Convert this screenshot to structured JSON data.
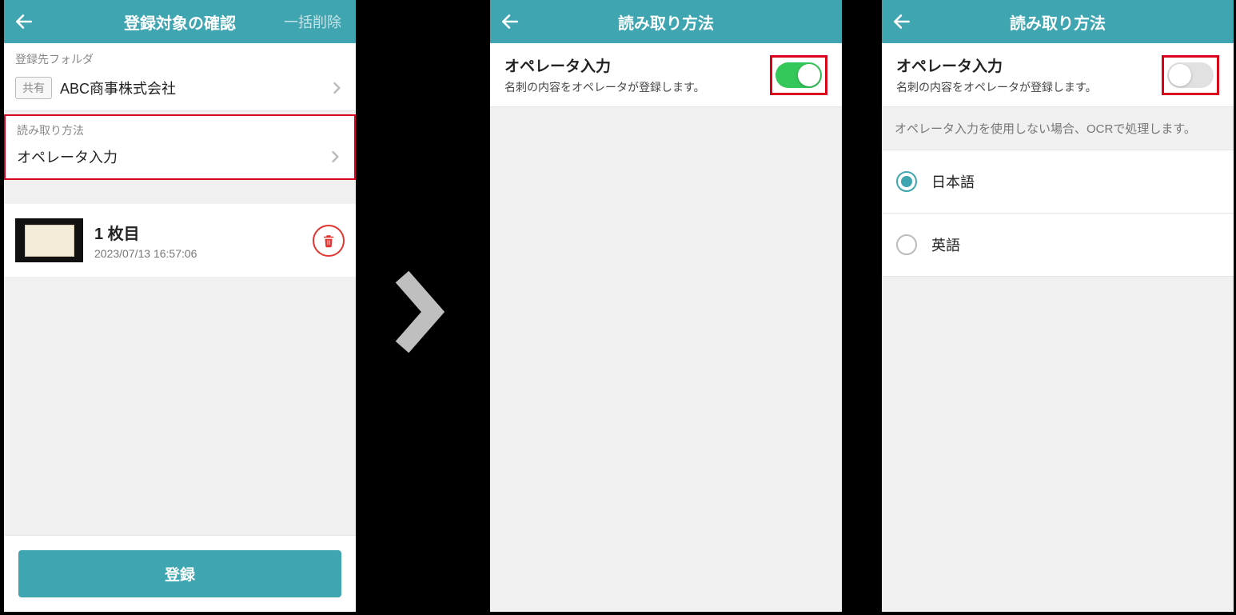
{
  "colors": {
    "primary": "#3FA5B0",
    "danger": "#e3342f",
    "highlight": "#d9001b",
    "toggle_on": "#34C759"
  },
  "screen1": {
    "header": {
      "title": "登録対象の確認",
      "bulk_delete": "一括削除"
    },
    "folder": {
      "section_label": "登録先フォルダ",
      "shared_badge": "共有",
      "name": "ABC商事株式会社"
    },
    "read_method": {
      "section_label": "読み取り方法",
      "value": "オペレータ入力"
    },
    "card": {
      "title": "1 枚目",
      "timestamp": "2023/07/13 16:57:06"
    },
    "submit_label": "登録"
  },
  "screen2": {
    "header": {
      "title": "読み取り方法"
    },
    "operator": {
      "label": "オペレータ入力",
      "desc": "名刺の内容をオペレータが登録します。",
      "enabled": true
    }
  },
  "screen3": {
    "header": {
      "title": "読み取り方法"
    },
    "operator": {
      "label": "オペレータ入力",
      "desc": "名刺の内容をオペレータが登録します。",
      "enabled": false
    },
    "helper": "オペレータ入力を使用しない場合、OCRで処理します。",
    "languages": [
      {
        "label": "日本語",
        "selected": true
      },
      {
        "label": "英語",
        "selected": false
      }
    ]
  }
}
